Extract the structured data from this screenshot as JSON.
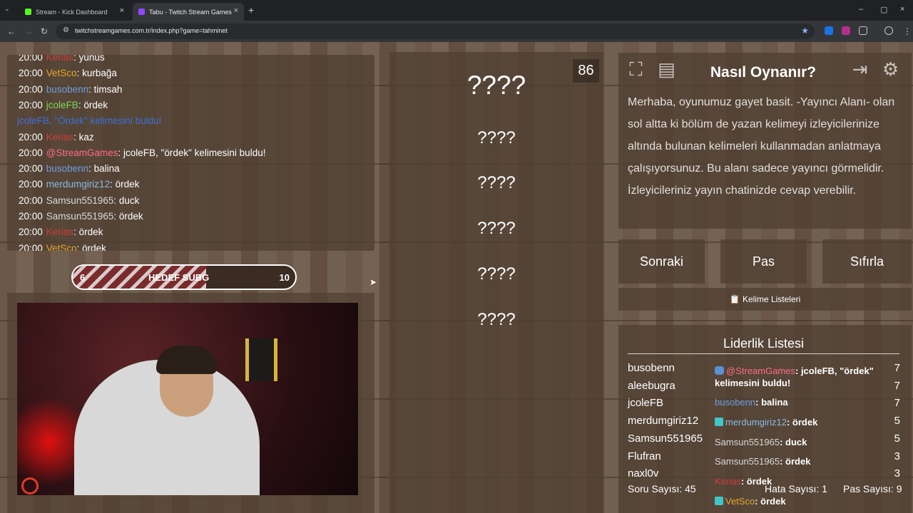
{
  "browser": {
    "tabs": [
      {
        "title": "Stream - Kick Dashboard",
        "favicon_color": "#53fc18"
      },
      {
        "title": "Tabu - Twitch Stream Games",
        "favicon_color": "#9146ff"
      }
    ],
    "url": "twitchstreamgames.com.tr/index.php?game=tahminet",
    "icons": {
      "back": "←",
      "forward": "→",
      "reload": "↻",
      "close": "×",
      "add": "+",
      "minimize": "–",
      "maximize": "▢",
      "star": "★",
      "tablist": "⌄"
    }
  },
  "chat": {
    "lines": [
      {
        "time": "20:00",
        "user": "Kerias",
        "user_color": "#d23b3b",
        "msg": "yunus"
      },
      {
        "time": "20:00",
        "user": "VetSco",
        "user_color": "#e5a72a",
        "msg": "kurbağa"
      },
      {
        "time": "20:00",
        "user": "busobenn",
        "user_color": "#6d9de0",
        "msg": "timsah"
      },
      {
        "time": "20:00",
        "user": "jcoleFB",
        "user_color": "#7ed957",
        "msg": "ördek"
      },
      {
        "time": "",
        "user": "jcoleFB, \"Ördek\" kelimesini buldu!",
        "user_color": "#3d6fd6",
        "msg": ""
      },
      {
        "time": "20:00",
        "user": "Kerias",
        "user_color": "#d23b3b",
        "msg": "kaz"
      },
      {
        "time": "20:00",
        "user": "@StreamGames",
        "user_color": "#ff6b8a",
        "msg": "jcoleFB, \"ördek\" kelimesini buldu!"
      },
      {
        "time": "20:00",
        "user": "busobenn",
        "user_color": "#6d9de0",
        "msg": "balina"
      },
      {
        "time": "20:00",
        "user": "merdumgiriz12",
        "user_color": "#8bb8e8",
        "msg": "ördek"
      },
      {
        "time": "20:00",
        "user": "Samsun551965",
        "user_color": "#d8d8d8",
        "msg": "duck"
      },
      {
        "time": "20:00",
        "user": "Samsun551965",
        "user_color": "#d8d8d8",
        "msg": "ördek"
      },
      {
        "time": "20:00",
        "user": "Kerias",
        "user_color": "#d23b3b",
        "msg": "ördek"
      },
      {
        "time": "20:00",
        "user": "VetSco",
        "user_color": "#e5a72a",
        "msg": "ördek"
      }
    ]
  },
  "goal": {
    "current": "6",
    "label": "HEDEF SUBG",
    "target": "10",
    "progress": 0.6
  },
  "game": {
    "timer": "86",
    "main_word": "????",
    "forbidden_words": [
      "????",
      "????",
      "????",
      "????",
      "????"
    ]
  },
  "howto": {
    "title": "Nasıl Oynanır?",
    "text": "Merhaba, oyunumuz gayet basit. -Yayıncı Alanı- olan sol altta ki bölüm de yazan kelimeyi izleyicilerinize altında bulunan kelimeleri kullanmadan anlatmaya çalışıyorsunuz. Bu alanı sadece yayıncı görmelidir. İzleyicileriniz yayın chatinizde cevap verebilir.",
    "icons": [
      "fullscreen-icon",
      "notes-icon",
      "exit-icon",
      "gear-icon"
    ]
  },
  "controls": {
    "next": "Sonraki",
    "pass": "Pas",
    "reset": "Sıfırla",
    "word_lists": "📋 Kelime Listeleri"
  },
  "leaderboard": {
    "title": "Liderlik Listesi",
    "rows": [
      {
        "name": "busobenn",
        "score": "7"
      },
      {
        "name": "aleebugra",
        "score": "7"
      },
      {
        "name": "jcoleFB",
        "score": "7"
      },
      {
        "name": "merdumgiriz12",
        "score": "5"
      },
      {
        "name": "Samsun551965",
        "score": "5"
      },
      {
        "name": "Flufran",
        "score": "3"
      },
      {
        "name": "naxl0v",
        "score": "3"
      }
    ],
    "overlay": [
      {
        "user": "@StreamGames",
        "user_color": "#ff6b8a",
        "msg": ": jcoleFB, \"ördek\"",
        "badge": "bot"
      },
      {
        "user": "",
        "user_color": "#ffffff",
        "msg": "kelimesini buldu!",
        "badge": ""
      },
      {
        "user": "busobenn",
        "user_color": "#6d9de0",
        "msg": ": balina",
        "badge": ""
      },
      {
        "user": "merdumgiriz12",
        "user_color": "#8bb8e8",
        "msg": ": ördek",
        "badge": "sub"
      },
      {
        "user": "Samsun551965",
        "user_color": "#d8d8d8",
        "msg": ": duck",
        "badge": ""
      },
      {
        "user": "Samsun551965",
        "user_color": "#d8d8d8",
        "msg": ": ördek",
        "badge": ""
      },
      {
        "user": "Kerias",
        "user_color": "#d23b3b",
        "msg": ": ördek",
        "badge": ""
      },
      {
        "user": "VetSco",
        "user_color": "#e5a72a",
        "msg": ": ördek",
        "badge": "sub"
      }
    ],
    "question_count": "Soru Sayısı: 45",
    "error_count": "Hata Sayısı: 1",
    "pass_count": "Pas Sayısı: 9"
  }
}
